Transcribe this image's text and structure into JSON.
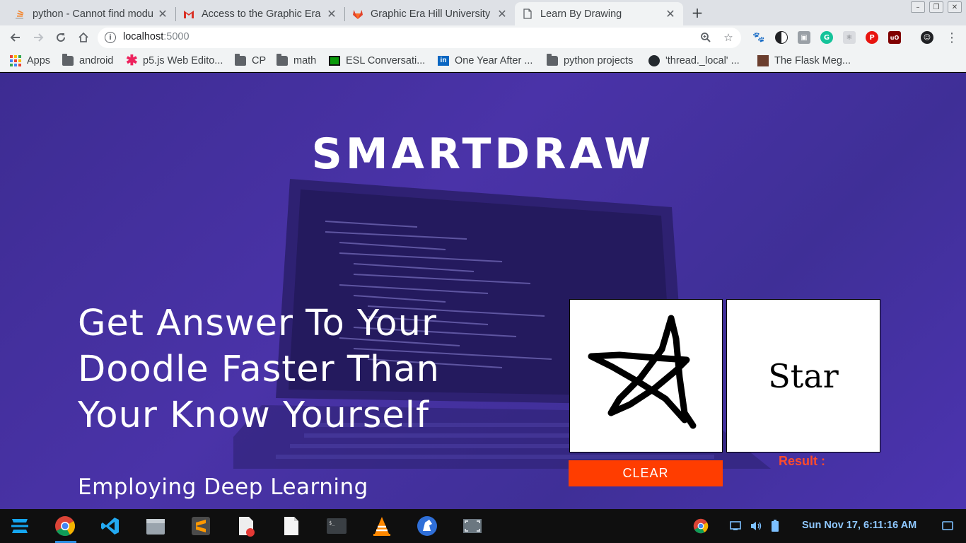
{
  "browser": {
    "tabs": [
      {
        "title": "python - Cannot find modu",
        "favicon": "stackoverflow-icon"
      },
      {
        "title": "Access to the Graphic Era",
        "favicon": "gmail-icon"
      },
      {
        "title": "Graphic Era Hill University",
        "favicon": "gitlab-icon"
      },
      {
        "title": "Learn By Drawing",
        "favicon": "page-icon"
      }
    ],
    "url_host": "localhost",
    "url_port": ":5000",
    "bookmarks": [
      {
        "label": "Apps",
        "icon": "apps-grid-icon"
      },
      {
        "label": "android",
        "icon": "folder-icon"
      },
      {
        "label": "p5.js Web Edito...",
        "icon": "p5-asterisk-icon"
      },
      {
        "label": "CP",
        "icon": "folder-icon"
      },
      {
        "label": "math",
        "icon": "folder-icon"
      },
      {
        "label": "ESL Conversati...",
        "icon": "green-square-icon"
      },
      {
        "label": "One Year After ...",
        "icon": "linkedin-icon"
      },
      {
        "label": "python projects",
        "icon": "folder-icon"
      },
      {
        "label": "'thread._local' ...",
        "icon": "github-icon"
      },
      {
        "label": "The Flask Meg...",
        "icon": "avatar-icon"
      }
    ]
  },
  "page": {
    "brand": "SMARTDRAW",
    "headline_lines": [
      "Get Answer To Your",
      "Doodle Faster Than",
      "Your Know Yourself"
    ],
    "subline": "Employing Deep Learning",
    "prediction": "Star",
    "clear_label": "CLEAR",
    "result_label": "Result :"
  },
  "taskbar": {
    "clock": "Sun Nov 17,  6:11:16 AM"
  },
  "colors": {
    "accent_button": "#ff3d00",
    "result_label": "#ff4b2b",
    "page_bg": "#4331a0"
  }
}
